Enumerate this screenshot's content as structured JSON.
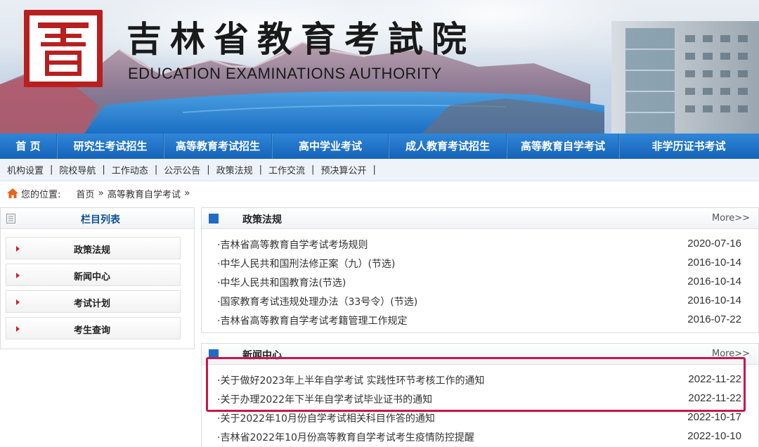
{
  "header": {
    "title_cn": "吉林省教育考試院",
    "title_en": "EDUCATION EXAMINATIONS AUTHORITY"
  },
  "main_nav": [
    {
      "label": "首 页",
      "w": 80
    },
    {
      "label": "研究生考试招生",
      "w": 150
    },
    {
      "label": "高等教育考试招生",
      "w": 152
    },
    {
      "label": "高中学业考试",
      "w": 164
    },
    {
      "label": "成人教育考试招生",
      "w": 166
    },
    {
      "label": "高等教育自学考试",
      "w": 158
    },
    {
      "label": "非学历证书考试",
      "w": 198
    }
  ],
  "sub_nav": [
    "机构设置",
    "院校导航",
    "工作动态",
    "公示公告",
    "政策法规",
    "工作交流",
    "预决算公开"
  ],
  "breadcrumb": {
    "prefix": "您的位置:",
    "home": "首页",
    "current": "高等教育自学考试"
  },
  "sidebar": {
    "title": "栏目列表",
    "items": [
      "政策法规",
      "新闻中心",
      "考试计划",
      "考生查询"
    ]
  },
  "panels": [
    {
      "title": "政策法规",
      "more": "More>>",
      "rows": [
        {
          "title": "·吉林省高等教育自学考试考场规则",
          "date": "2020-07-16"
        },
        {
          "title": "·中华人民共和国刑法修正案（九）(节选)",
          "date": "2016-10-14"
        },
        {
          "title": "·中华人民共和国教育法(节选)",
          "date": "2016-10-14"
        },
        {
          "title": "·国家教育考试违规处理办法（33号令）(节选)",
          "date": "2016-10-14"
        },
        {
          "title": "·吉林省高等教育自学考试考籍管理工作规定",
          "date": "2016-07-22"
        }
      ]
    },
    {
      "title": "新闻中心",
      "more": "More>>",
      "rows": [
        {
          "title": "·关于做好2023年上半年自学考试 实践性环节考核工作的通知",
          "date": "2022-11-22"
        },
        {
          "title": "·关于办理2022年下半年自学考试毕业证书的通知",
          "date": "2022-11-22"
        },
        {
          "title": "·关于2022年10月份自学考试相关科目作答的通知",
          "date": "2022-10-17"
        },
        {
          "title": "·吉林省2022年10月份高等教育自学考试考生疫情防控提醒",
          "date": "2022-10-10"
        }
      ]
    }
  ]
}
